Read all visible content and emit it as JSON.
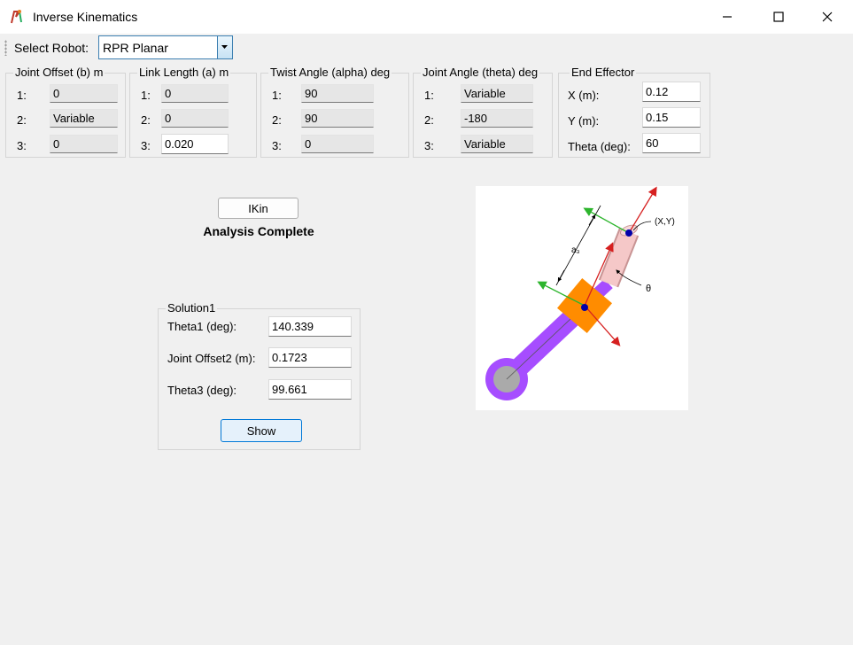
{
  "window": {
    "title": "Inverse Kinematics",
    "icons": [
      "app-icon",
      "minimize-icon",
      "maximize-icon",
      "close-icon"
    ]
  },
  "toolbar": {
    "select_label": "Select Robot:",
    "robot_selected": "RPR Planar"
  },
  "parameters": {
    "joint_offset": {
      "title": "Joint Offset (b) m",
      "rows": [
        {
          "label": "1:",
          "value": "0"
        },
        {
          "label": "2:",
          "value": "Variable"
        },
        {
          "label": "3:",
          "value": "0"
        }
      ]
    },
    "link_length": {
      "title": "Link Length (a) m",
      "rows": [
        {
          "label": "1:",
          "value": "0"
        },
        {
          "label": "2:",
          "value": "0"
        },
        {
          "label": "3:",
          "value": "0.020"
        }
      ]
    },
    "twist_angle": {
      "title": "Twist Angle (alpha) deg",
      "rows": [
        {
          "label": "1:",
          "value": "90"
        },
        {
          "label": "2:",
          "value": "90"
        },
        {
          "label": "3:",
          "value": "0"
        }
      ]
    },
    "joint_angle": {
      "title": "Joint Angle (theta) deg",
      "rows": [
        {
          "label": "1:",
          "value": "Variable"
        },
        {
          "label": "2:",
          "value": "-180"
        },
        {
          "label": "3:",
          "value": "Variable"
        }
      ]
    },
    "end_effector": {
      "title": "End Effector",
      "rows": [
        {
          "label": "X (m):",
          "value": "0.12"
        },
        {
          "label": "Y (m):",
          "value": "0.15"
        },
        {
          "label": "Theta (deg):",
          "value": "60"
        }
      ]
    }
  },
  "actions": {
    "ikin_label": "IKin",
    "status": "Analysis Complete",
    "show_label": "Show"
  },
  "solution": {
    "title": "Solution1",
    "rows": [
      {
        "label": "Theta1 (deg):",
        "value": "140.339"
      },
      {
        "label": "Joint Offset2 (m):",
        "value": "0.1723"
      },
      {
        "label": "Theta3 (deg):",
        "value": "99.661"
      }
    ]
  },
  "diagram": {
    "label_xy": "(X,Y)",
    "label_a3": "a₃",
    "label_theta": "θ",
    "colors": {
      "link1": "#a64dff",
      "link2": "#f5c8c8",
      "slider": "#ff8c00",
      "axis_x": "#d62020",
      "axis_z": "#2db52d",
      "joint": "#0000aa",
      "base": "#aaaaaa"
    }
  }
}
